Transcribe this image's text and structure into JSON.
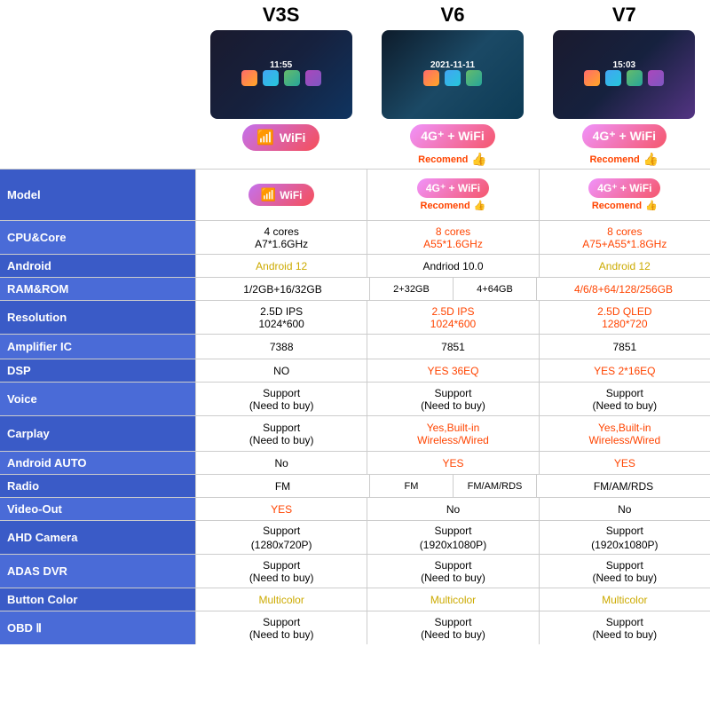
{
  "products": [
    {
      "name": "V3S",
      "image_style": "screen-v3s",
      "badge_type": "wifi",
      "badge_label": "WiFi",
      "recommend": false
    },
    {
      "name": "V6",
      "image_style": "screen-v6",
      "badge_type": "4g-wifi",
      "badge_label": "4G⁺+ WiFi",
      "recommend": true
    },
    {
      "name": "V7",
      "image_style": "screen-v7",
      "badge_type": "4g-wifi",
      "badge_label": "4G⁺+ WiFi",
      "recommend": true
    }
  ],
  "rows": [
    {
      "label": "Model",
      "cells": [
        {
          "type": "badge-wifi",
          "badge": "WiFi"
        },
        {
          "type": "badge-4g",
          "badge": "4G⁺ + WiFi",
          "recommend": true
        },
        {
          "type": "badge-4g",
          "badge": "4G⁺ + WiFi",
          "recommend": true
        }
      ]
    },
    {
      "label": "CPU&Core",
      "cells": [
        {
          "type": "normal",
          "text": "4 cores\nA7*1.6GHz"
        },
        {
          "type": "orange",
          "text": "8 cores\nA55*1.6GHz"
        },
        {
          "type": "orange",
          "text": "8 cores\nA75+A55*1.8GHz"
        }
      ]
    },
    {
      "label": "Android",
      "cells": [
        {
          "type": "yellow",
          "text": "Android 12"
        },
        {
          "type": "normal",
          "text": "Andriod 10.0"
        },
        {
          "type": "yellow",
          "text": "Android 12"
        }
      ]
    },
    {
      "label": "RAM&ROM",
      "cells": [
        {
          "type": "normal",
          "text": "1/2GB+16/32GB"
        },
        {
          "type": "split",
          "parts": [
            "2+32GB",
            "4+64GB"
          ]
        },
        {
          "type": "orange",
          "text": "4/6/8+64/128/256GB"
        }
      ]
    },
    {
      "label": "Resolution",
      "cells": [
        {
          "type": "normal",
          "text": "2.5D IPS\n1024*600"
        },
        {
          "type": "orange",
          "text": "2.5D IPS\n1024*600"
        },
        {
          "type": "orange",
          "text": "2.5D QLED\n1280*720"
        }
      ]
    },
    {
      "label": "Amplifier IC",
      "cells": [
        {
          "type": "normal",
          "text": "7388"
        },
        {
          "type": "normal",
          "text": "7851"
        },
        {
          "type": "normal",
          "text": "7851"
        }
      ]
    },
    {
      "label": "DSP",
      "cells": [
        {
          "type": "normal",
          "text": "NO"
        },
        {
          "type": "orange",
          "text": "YES 36EQ"
        },
        {
          "type": "orange",
          "text": "YES 2*16EQ"
        }
      ]
    },
    {
      "label": "Voice",
      "cells": [
        {
          "type": "normal",
          "text": "Support\n(Need to buy)"
        },
        {
          "type": "normal",
          "text": "Support\n(Need to buy)"
        },
        {
          "type": "normal",
          "text": "Support\n(Need to buy)"
        }
      ]
    },
    {
      "label": "Carplay",
      "cells": [
        {
          "type": "normal",
          "text": "Support\n(Need to buy)"
        },
        {
          "type": "orange",
          "text": "Yes,Built-in\nWireless/Wired"
        },
        {
          "type": "orange",
          "text": "Yes,Built-in\nWireless/Wired"
        }
      ]
    },
    {
      "label": "Android AUTO",
      "cells": [
        {
          "type": "normal",
          "text": "No"
        },
        {
          "type": "orange",
          "text": "YES"
        },
        {
          "type": "orange",
          "text": "YES"
        }
      ]
    },
    {
      "label": "Radio",
      "cells": [
        {
          "type": "normal",
          "text": "FM"
        },
        {
          "type": "split-radio",
          "parts": [
            "FM",
            "FM/AM/RDS"
          ]
        },
        {
          "type": "normal",
          "text": "FM/AM/RDS"
        }
      ]
    },
    {
      "label": "Video-Out",
      "cells": [
        {
          "type": "orange",
          "text": "YES"
        },
        {
          "type": "normal",
          "text": "No"
        },
        {
          "type": "normal",
          "text": "No"
        }
      ]
    },
    {
      "label": "AHD Camera",
      "cells": [
        {
          "type": "mixed",
          "main": "Support",
          "sub": "(1280x720P)",
          "sub_color": "orange"
        },
        {
          "type": "mixed",
          "main": "Support",
          "sub": "(1920x1080P)",
          "sub_color": "orange"
        },
        {
          "type": "mixed",
          "main": "Support",
          "sub": "(1920x1080P)",
          "sub_color": "orange"
        }
      ]
    },
    {
      "label": "ADAS DVR",
      "cells": [
        {
          "type": "normal",
          "text": "Support\n(Need to buy)"
        },
        {
          "type": "normal",
          "text": "Support\n(Need to buy)"
        },
        {
          "type": "normal",
          "text": "Support\n(Need to buy)"
        }
      ]
    },
    {
      "label": "Button Color",
      "cells": [
        {
          "type": "yellow",
          "text": "Multicolor"
        },
        {
          "type": "yellow",
          "text": "Multicolor"
        },
        {
          "type": "yellow",
          "text": "Multicolor"
        }
      ]
    },
    {
      "label": "OBD Ⅱ",
      "cells": [
        {
          "type": "normal",
          "text": "Support\n(Need to buy)"
        },
        {
          "type": "normal",
          "text": "Support\n(Need to buy)"
        },
        {
          "type": "normal",
          "text": "Support\n(Need to buy)"
        }
      ]
    }
  ]
}
